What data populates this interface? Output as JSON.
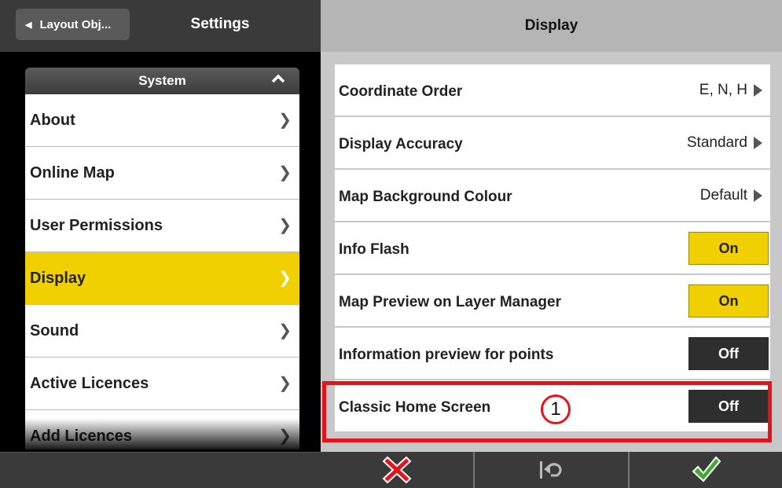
{
  "left_header": {
    "back_label": "Layout Obj...",
    "title": "Settings"
  },
  "system_group": {
    "header": "System",
    "items": [
      {
        "label": "About",
        "selected": false
      },
      {
        "label": "Online Map",
        "selected": false
      },
      {
        "label": "User Permissions",
        "selected": false
      },
      {
        "label": "Display",
        "selected": true
      },
      {
        "label": "Sound",
        "selected": false
      },
      {
        "label": "Active Licences",
        "selected": false
      },
      {
        "label": "Add Licences",
        "selected": false
      }
    ]
  },
  "right_header": {
    "title": "Display"
  },
  "display_settings": [
    {
      "label": "Coordinate Order",
      "value": "E, N, H",
      "type": "select"
    },
    {
      "label": "Display Accuracy",
      "value": "Standard",
      "type": "select"
    },
    {
      "label": "Map Background Colour",
      "value": "Default",
      "type": "select"
    },
    {
      "label": "Info Flash",
      "value": "On",
      "type": "toggle"
    },
    {
      "label": "Map Preview on Layer Manager",
      "value": "On",
      "type": "toggle"
    },
    {
      "label": "Information preview for points",
      "value": "Off",
      "type": "toggle"
    },
    {
      "label": "Classic Home Screen",
      "value": "Off",
      "type": "toggle"
    }
  ],
  "callout": {
    "number": "1"
  },
  "bottom_toolbar": {
    "buttons": [
      "cancel-icon",
      "undo-icon",
      "confirm-icon"
    ]
  },
  "colors": {
    "accent_yellow": "#f0d000",
    "highlight_red": "#e8131a",
    "toggle_off": "#2e2e2e"
  }
}
